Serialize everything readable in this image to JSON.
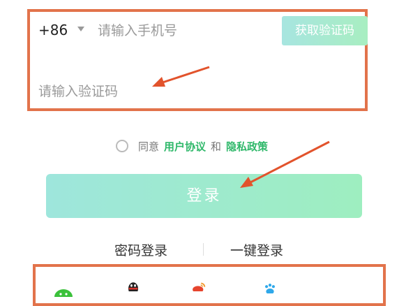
{
  "phone": {
    "country_code": "+86",
    "placeholder": "请输入手机号"
  },
  "get_code_button": "获取验证码",
  "code": {
    "placeholder": "请输入验证码"
  },
  "agreement": {
    "prefix": "同意",
    "user_agreement": "用户协议",
    "and": "和",
    "privacy_policy": "隐私政策"
  },
  "login_button": "登录",
  "alt_logins": {
    "password": "密码登录",
    "one_click": "一键登录"
  },
  "social_icons": [
    "wechat-icon",
    "qq-icon",
    "weibo-icon",
    "baidu-icon"
  ],
  "colors": {
    "annotation": "#e2734b",
    "accent": "#2fb86a",
    "button_start": "#9ee6dc",
    "button_end": "#9eeec0"
  }
}
